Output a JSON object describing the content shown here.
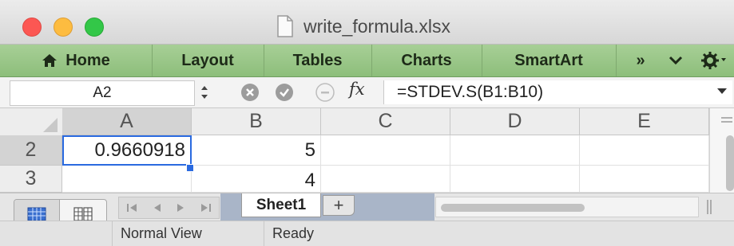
{
  "window": {
    "title": "write_formula.xlsx",
    "controls": [
      "close",
      "minimize",
      "zoom"
    ]
  },
  "ribbon": {
    "tabs": [
      {
        "label": "Home",
        "icon": "home-icon"
      },
      {
        "label": "Layout"
      },
      {
        "label": "Tables"
      },
      {
        "label": "Charts"
      },
      {
        "label": "SmartArt"
      }
    ],
    "more_label": "»",
    "collapse_icon": "chevron-down-icon",
    "settings_icon": "gear-icon"
  },
  "formula_bar": {
    "name_box": "A2",
    "fx_label": "fx",
    "formula": "=STDEV.S(B1:B10)"
  },
  "grid": {
    "columns": [
      "A",
      "B",
      "C",
      "D",
      "E"
    ],
    "selected_column": "A",
    "rows": [
      {
        "header": "2",
        "cells": [
          "0.9660918",
          "5",
          "",
          "",
          ""
        ]
      },
      {
        "header": "3",
        "cells": [
          "",
          "4",
          "",
          "",
          ""
        ]
      }
    ],
    "active_cell": "A2"
  },
  "sheets": {
    "tabs": [
      {
        "label": "Sheet1",
        "active": true
      }
    ],
    "add_label": "+"
  },
  "status": {
    "view": "Normal View",
    "state": "Ready"
  },
  "colors": {
    "ribbon": "#9cc78a",
    "selection": "#2a6ae0",
    "sheet_strip": "#a9b5c8"
  }
}
